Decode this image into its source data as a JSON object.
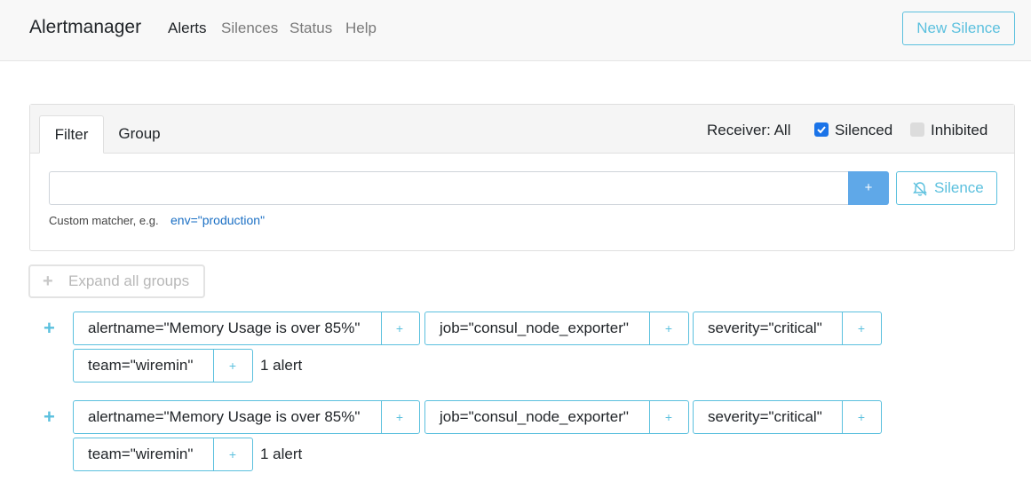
{
  "navbar": {
    "brand": "Alertmanager",
    "links": [
      "Alerts",
      "Silences",
      "Status",
      "Help"
    ],
    "active": "Alerts",
    "new_silence": "New Silence"
  },
  "filter_card": {
    "tabs": [
      "Filter",
      "Group"
    ],
    "active_tab": "Filter",
    "receiver": "Receiver: All",
    "silenced_label": "Silenced",
    "silenced_checked": true,
    "inhibited_label": "Inhibited",
    "inhibited_checked": false,
    "input_value": "",
    "input_placeholder": "",
    "add_label": "+",
    "silence_button": "Silence",
    "hint": "Custom matcher, e.g.",
    "hint_example": "env=\"production\""
  },
  "expand_all": "Expand all groups",
  "groups": [
    {
      "expand_icon": "+",
      "matchers": [
        "alertname=\"Memory Usage is over 85%\"",
        "job=\"consul_node_exporter\"",
        "severity=\"critical\"",
        "team=\"wiremin\""
      ],
      "count": "1 alert"
    },
    {
      "expand_icon": "+",
      "matchers": [
        "alertname=\"Memory Usage is over 85%\"",
        "job=\"consul_node_exporter\"",
        "severity=\"critical\"",
        "team=\"wiremin\""
      ],
      "count": "1 alert"
    }
  ],
  "matcher_plus": "+",
  "colors": {
    "accent": "#5bc0de",
    "primary_button": "#5fa8e8",
    "checkbox": "#1a73e8",
    "navbar_bg": "#f8f8f8"
  }
}
